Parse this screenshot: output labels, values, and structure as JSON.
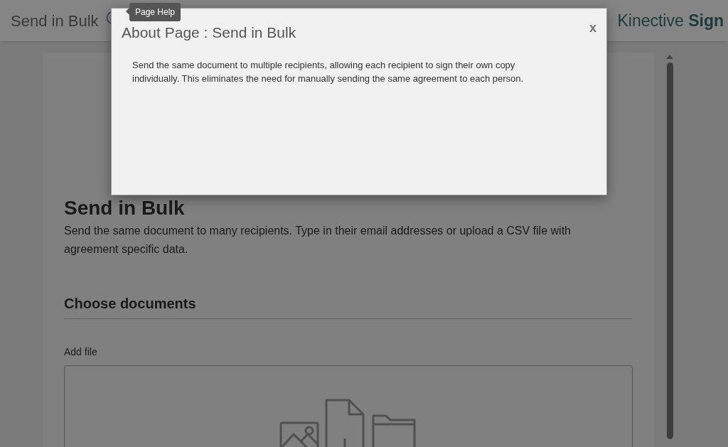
{
  "header": {
    "title": "Send in Bulk",
    "brand": {
      "light": "Kinective",
      "bold": "Sign"
    }
  },
  "tooltip": {
    "text": "Page Help"
  },
  "page": {
    "heading": "Send in Bulk",
    "description": "Send the same document to many recipients. Type in their email addresses or upload a CSV file with agreement specific data.",
    "section": "Choose documents",
    "field_label": "Add file"
  },
  "modal": {
    "title": "About Page : Send in Bulk",
    "close": "x",
    "body": "Send the same document to multiple recipients, allowing each recipient to sign their own copy individually. This eliminates the need for manually sending the same agreement to each person."
  }
}
